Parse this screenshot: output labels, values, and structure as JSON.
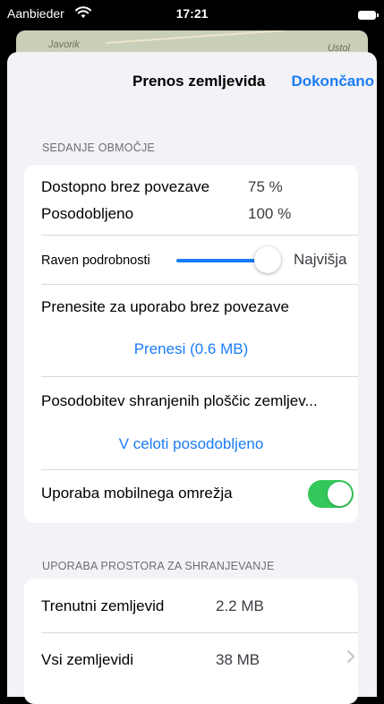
{
  "status_bar": {
    "carrier": "Aanbieder",
    "time": "17:21"
  },
  "map_peek": {
    "label_left": "Javorik",
    "label_right": "Ustol"
  },
  "nav": {
    "title": "Prenos zemljevida",
    "done_label": "Dokončano"
  },
  "area_section": {
    "header": "SEDANJE OBMOČJE",
    "offline_label": "Dostopno brez povezave",
    "offline_value": "75 %",
    "updated_label": "Posodobljeno",
    "updated_value": "100 %",
    "detail_label": "Raven podrobnosti",
    "detail_level_fraction": 1.0,
    "detail_value": "Najvišja",
    "download_title": "Prenesite za uporabo brez povezave",
    "download_button": "Prenesi (0.6 MB)",
    "update_title": "Posodobitev shranjenih ploščic zemljev...",
    "update_status": "V celoti posodobljeno",
    "cellular_label": "Uporaba mobilnega omrežja",
    "cellular_enabled": true
  },
  "storage_section": {
    "header": "UPORABA PROSTORA ZA SHRANJEVANJE",
    "current_label": "Trenutni zemljevid",
    "current_value": "2.2 MB",
    "all_label": "Vsi zemljevidi",
    "all_value": "38 MB"
  },
  "colors": {
    "accent": "#1a7cf5",
    "toggle_on": "#34c759",
    "background": "#f2f2f7"
  }
}
